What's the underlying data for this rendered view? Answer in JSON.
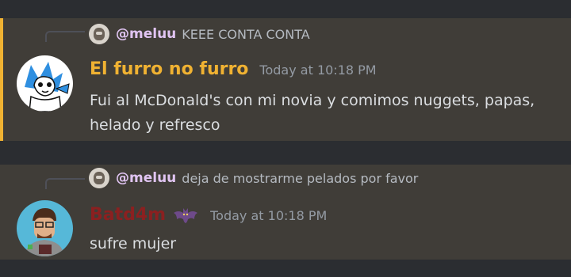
{
  "colors": {
    "background": "#2b2d31",
    "message_bg": "#403d38",
    "highlight_bar": "#f0b232",
    "username_1": "#f0b232",
    "username_2": "#8b2020",
    "mention": "#e0c4f2",
    "timestamp": "#949ba4"
  },
  "messages": [
    {
      "reply": {
        "mention": "@meluu",
        "text": "KEEE CONTA CONTA"
      },
      "author": "El furro no furro",
      "timestamp": "Today at 10:18 PM",
      "content": "Fui al McDonald's con mi novia y comimos nuggets, papas, helado y refresco"
    },
    {
      "reply": {
        "mention": "@meluu",
        "text": "deja de mostrarme pelados por favor"
      },
      "author": "Batd4m",
      "author_icon": "bat-icon",
      "timestamp": "Today at 10:18 PM",
      "content": "sufre mujer"
    }
  ]
}
